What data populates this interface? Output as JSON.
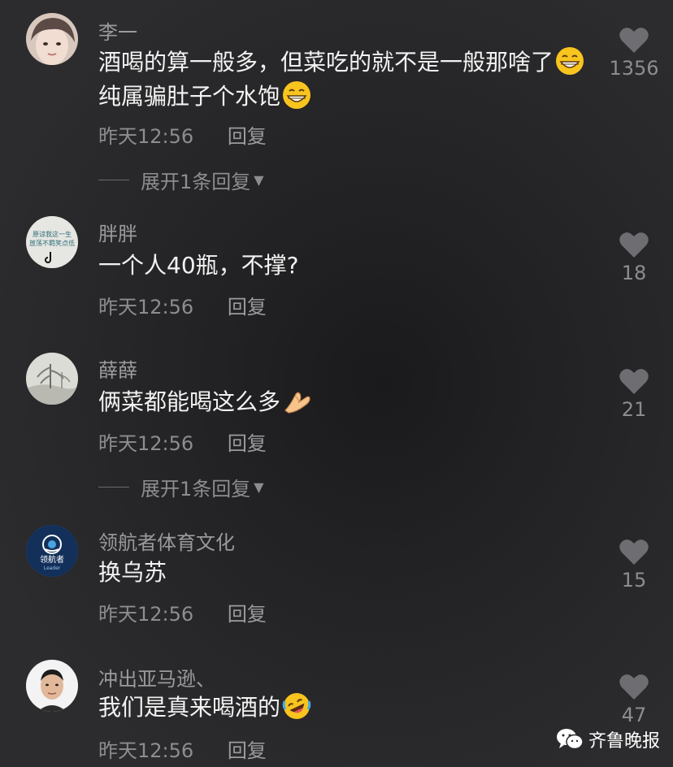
{
  "comments": [
    {
      "username": "李一",
      "text_parts": [
        "酒喝的算一般多，但菜吃的就不是一般那啥了",
        "纯属骗肚子个水饱",
        ""
      ],
      "emojis": [
        "grinning-face",
        "grinning-face"
      ],
      "time": "昨天12:56",
      "reply_label": "回复",
      "likes": "1356",
      "expand_label": "展开1条回复"
    },
    {
      "username": "胖胖",
      "avatar_text": [
        "原谅我这一生",
        "放荡不羁笑点低"
      ],
      "text": "一个人40瓶，不撑?",
      "time": "昨天12:56",
      "reply_label": "回复",
      "likes": "18"
    },
    {
      "username": "薛薛",
      "text": "俩菜都能喝这么多",
      "emoji": "pinching-hand",
      "time": "昨天12:56",
      "reply_label": "回复",
      "likes": "21",
      "expand_label": "展开1条回复"
    },
    {
      "username": "领航者体育文化",
      "avatar_text": [
        "领航者",
        "Leader"
      ],
      "text": "换乌苏",
      "time": "昨天12:56",
      "reply_label": "回复",
      "likes": "15"
    },
    {
      "username": "冲出亚马逊、",
      "text": "我们是真来喝酒的",
      "emoji": "rolling-on-floor-laughing",
      "time": "昨天12:56",
      "reply_label": "回复",
      "likes": "47"
    }
  ],
  "watermark": {
    "text": "齐鲁晚报",
    "icon": "wechat-icon"
  },
  "colors": {
    "background": "#2c2c2e",
    "muted_text": "#8d8d91",
    "primary_text": "#f2f2f2",
    "heart": "#6e6e72"
  }
}
